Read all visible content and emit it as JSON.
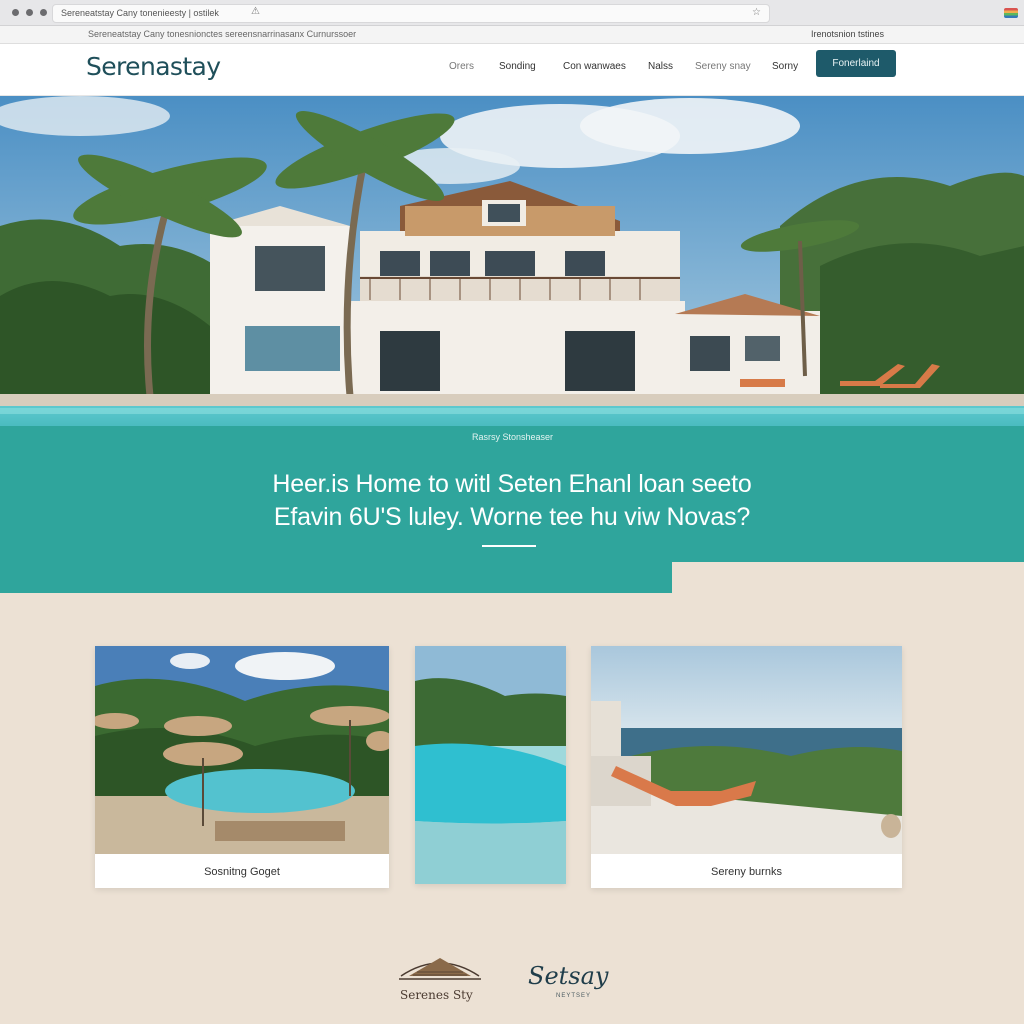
{
  "browser": {
    "address": "Sereneatstay   Cany   tonenieesty   |  ostilek",
    "toolbar_left": "Sereneatstay  Cany  tonesnionctes  sereensnarrinasanx  Curnurssoer",
    "toolbar_right": "Irenotsnion tstines"
  },
  "header": {
    "logo": "Serenastay",
    "nav": [
      "Orers",
      "Sonding",
      "Con wanwaes",
      "Nalss",
      "Sereny snay",
      "Sorny"
    ],
    "cta": "Fonerlaind"
  },
  "hero": {
    "pool_caption": "Rasrsy Stonsheaser",
    "headline_line1": "Heer.is Home to witl Seten Ehanl loan seeto",
    "headline_line2": "Efavin 6U'S luley. Worne tee hu viw Novas?"
  },
  "cards": [
    {
      "label": "Sosnitng Goget"
    },
    {
      "label": ""
    },
    {
      "label": "Sereny burnks"
    }
  ],
  "footer": {
    "logo1_text": "Serenes Sty",
    "logo2_text": "Setsay",
    "logo2_sub": "NEYTSEY"
  },
  "colors": {
    "brand": "#1e5a6a",
    "teal": "#2fa59c",
    "sand": "#ece1d4"
  }
}
